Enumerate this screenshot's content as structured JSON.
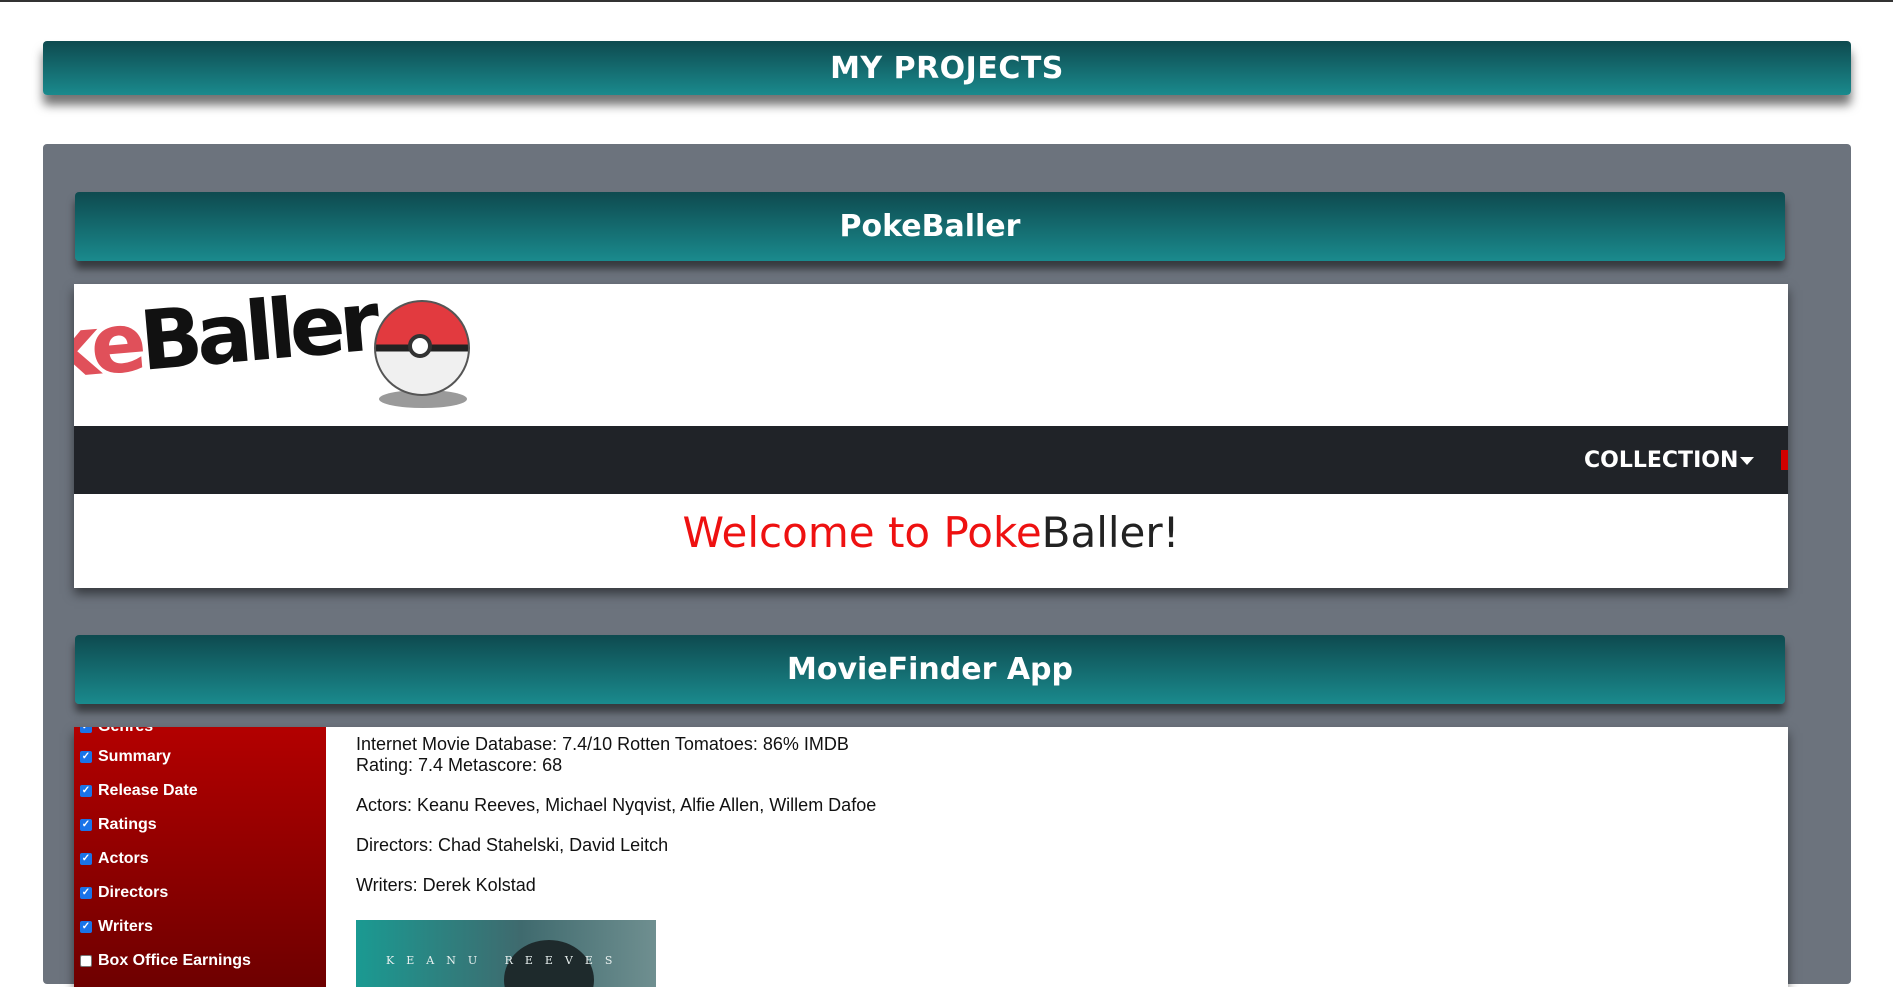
{
  "header": {
    "title": "MY PROJECTS"
  },
  "projects": [
    {
      "title": "PokeBaller",
      "logo_text_red": "ke",
      "logo_text_black": "Baller",
      "nav": {
        "collection_label": "COLLECTION",
        "caret_icon": "caret-down-icon"
      },
      "welcome": {
        "part_red": "Welcome to Poke",
        "part_black": "Baller!"
      }
    },
    {
      "title": "MovieFinder App",
      "sidebar": {
        "partial_label": "Genres",
        "items": [
          {
            "label": "Summary",
            "checked": true
          },
          {
            "label": "Release Date",
            "checked": true
          },
          {
            "label": "Ratings",
            "checked": true
          },
          {
            "label": "Actors",
            "checked": true
          },
          {
            "label": "Directors",
            "checked": true
          },
          {
            "label": "Writers",
            "checked": true
          },
          {
            "label": "Box Office Earnings",
            "checked": false
          }
        ]
      },
      "details": {
        "ratings_line1": "Internet Movie Database: 7.4/10 Rotten Tomatoes: 86% IMDB",
        "ratings_line2": "Rating: 7.4 Metascore: 68",
        "actors": "Actors: Keanu Reeves, Michael Nyqvist, Alfie Allen, Willem Dafoe",
        "directors": "Directors: Chad Stahelski, David Leitch",
        "writers": "Writers: Derek Kolstad"
      },
      "poster": {
        "title": "KEANU REEVES"
      }
    }
  ],
  "colors": {
    "header_gradient_top": "#0e4a4f",
    "header_gradient_bottom": "#1a8a8d",
    "panel_bg": "#6c737d",
    "pokeballer_red": "#ee1111",
    "sidebar_red": "#b30000",
    "navbar_dark": "#202328"
  }
}
